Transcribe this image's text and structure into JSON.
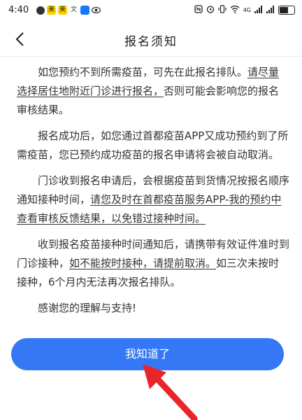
{
  "status_bar": {
    "time": "4:40",
    "network_label": "4G",
    "left_icons": [
      "message-icon",
      "meituan-icon",
      "meituan-icon",
      "text-icon",
      "app-icon",
      "eye-icon"
    ],
    "right_icons": [
      "nfc-icon",
      "alarm-icon",
      "vibrate-icon",
      "wifi-icon",
      "signal-icon",
      "signal-icon",
      "battery-icon"
    ]
  },
  "nav": {
    "title": "报名须知"
  },
  "notice": {
    "p1": {
      "a": "如您预约不到所需疫苗，可先在此报名排队。",
      "b": "请尽量选择居住地附近门诊进行报名，",
      "c": "否则可能会影响您的报名审核结果。"
    },
    "p2": "报名成功后，如您通过首都疫苗APP又成功预约到了所需疫苗，您已预约成功疫苗的报名申请将会被自动取消。",
    "p3": {
      "a": "门诊收到报名申请后，会根据疫苗到货情况按报名顺序通知接种时间，",
      "b": "请您及时在首都疫苗服务APP-我的预约中查看审核反馈结果，以免错过接种时间。"
    },
    "p4": {
      "a": "收到报名疫苗接种时间通知后，请携带有效证件准时到门诊接种，",
      "b": "如不能按时接种，请提前取消。",
      "c": "如三次未按时接种，6个月内无法再次报名排队。"
    },
    "p5": "感谢您的理解与支持!"
  },
  "confirm_button": {
    "label": "我知道了"
  },
  "colors": {
    "accent": "#3478f6",
    "annotation_arrow": "#e8262a"
  }
}
